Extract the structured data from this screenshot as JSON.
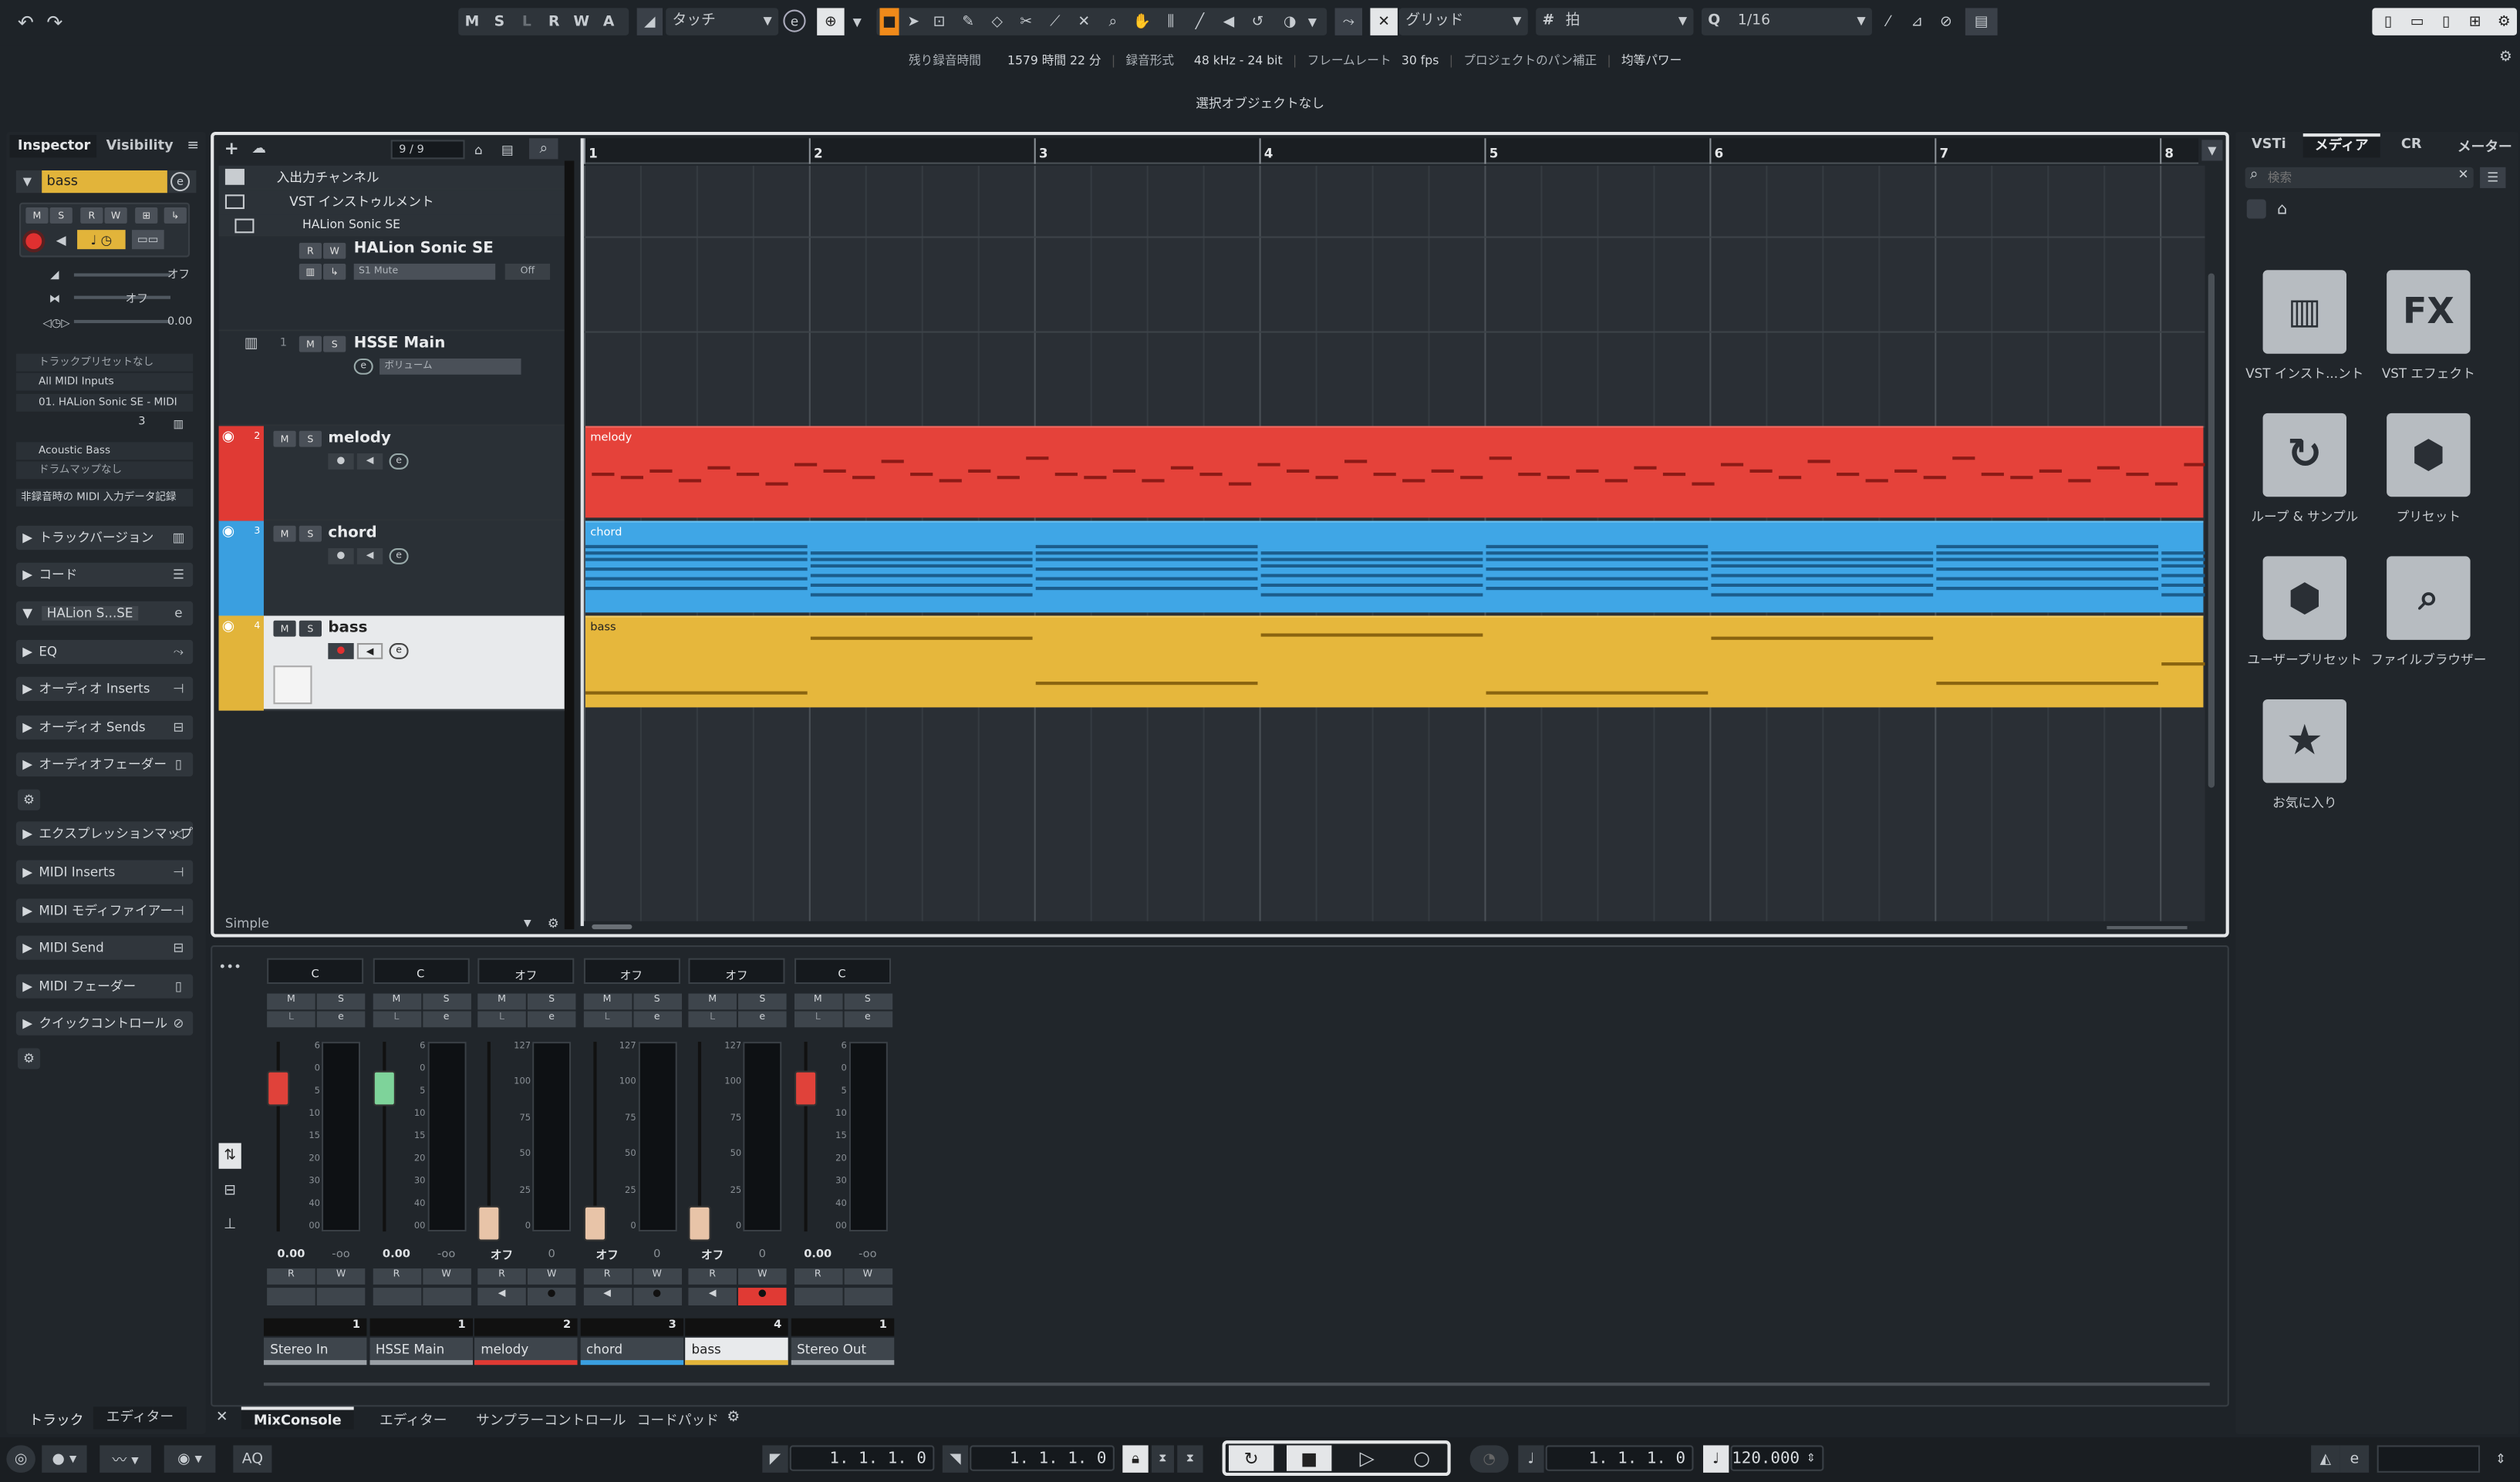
{
  "toolbar": {
    "mode_buttons": [
      "M",
      "S",
      "L",
      "R",
      "W",
      "A"
    ],
    "automation_mode": "タッチ",
    "snap_type": "グリッド",
    "grid_type": "拍",
    "quantize": "1/16"
  },
  "status_bar": {
    "rec_time_label": "残り録音時間",
    "rec_time_value": "1579 時間 22 分",
    "rec_format_label": "録音形式",
    "rec_format_value": "48 kHz - 24 bit",
    "frame_rate_label": "フレームレート",
    "frame_rate_value": "30 fps",
    "pan_label": "プロジェクトのパン補正",
    "pan_value": "均等パワー"
  },
  "info_line": "選択オブジェクトなし",
  "inspector": {
    "tabs": [
      "Inspector",
      "Visibility"
    ],
    "track_name": "bass",
    "volume_off": "オフ",
    "pan_off": "オフ",
    "delay": "0.00",
    "preset": "トラックプリセットなし",
    "input": "All MIDI Inputs",
    "output": "01. HALion Sonic SE - MIDI",
    "channel": "3",
    "program": "Acoustic Bass",
    "drum_map": "ドラムマップなし",
    "midi_input_rec": "非録音時の MIDI 入力データ記録",
    "sections": [
      "トラックバージョン",
      "コード",
      "HALion S...SE",
      "EQ",
      "オーディオ Inserts",
      "オーディオ Sends",
      "オーディオフェーダー",
      "エクスプレッションマップ",
      "MIDI Inserts",
      "MIDI モディファイアー",
      "MIDI Send",
      "MIDI フェーダー",
      "クイックコントロール"
    ]
  },
  "tracklist": {
    "counter": "9 / 9",
    "folder_io": "入出力チャンネル",
    "folder_vst": "VST インストゥルメント",
    "folder_halion": "HALion Sonic SE",
    "instrument": "HALion Sonic SE",
    "mute_label": "S1 Mute",
    "mute_value": "Off",
    "hsse_name": "HSSE Main",
    "hsse_num": "1",
    "hsse_vol": "ボリューム",
    "tracks": [
      {
        "num": "2",
        "name": "melody",
        "color": "#e03a34"
      },
      {
        "num": "3",
        "name": "chord",
        "color": "#3a9fe0"
      },
      {
        "num": "4",
        "name": "bass",
        "color": "#e2b43a"
      }
    ],
    "footer": "Simple"
  },
  "ruler": [
    "1",
    "2",
    "3",
    "4",
    "5",
    "6",
    "7",
    "8"
  ],
  "parts": {
    "melody": "melody",
    "chord": "chord",
    "bass": "bass"
  },
  "right_zone": {
    "tabs": [
      "VSTi",
      "メディア",
      "CR",
      "メーター"
    ],
    "search_placeholder": "検索",
    "tiles": [
      "VST インスト...ント",
      "VST エフェクト",
      "ループ & サンプル",
      "プリセット",
      "ユーザープリセット",
      "ファイルブラウザー",
      "お気に入り"
    ]
  },
  "mixer": {
    "channels": [
      {
        "name": "Stereo In",
        "num": "1",
        "top": "C",
        "val": "0.00",
        "peak": "-oo",
        "fader": "red"
      },
      {
        "name": "HSSE Main",
        "num": "1",
        "top": "C",
        "val": "0.00",
        "peak": "-oo",
        "fader": "green"
      },
      {
        "name": "melody",
        "num": "2",
        "top": "オフ",
        "val": "オフ",
        "peak": "0",
        "fader": "midi"
      },
      {
        "name": "chord",
        "num": "3",
        "top": "オフ",
        "val": "オフ",
        "peak": "0",
        "fader": "midi"
      },
      {
        "name": "bass",
        "num": "4",
        "top": "オフ",
        "val": "オフ",
        "peak": "0",
        "fader": "midi"
      },
      {
        "name": "Stereo Out",
        "num": "1",
        "top": "C",
        "val": "0.00",
        "peak": "-oo",
        "fader": "red"
      }
    ],
    "audio_scale": [
      "6",
      "0",
      "5",
      "10",
      "15",
      "20",
      "30",
      "40",
      "00"
    ],
    "midi_scale": [
      "127",
      "100",
      "75",
      "50",
      "25",
      "0"
    ]
  },
  "bottom_tabs": {
    "left": [
      "トラック",
      "エディター"
    ],
    "main": [
      "MixConsole",
      "エディター",
      "サンプラーコントロール",
      "コードパッド"
    ]
  },
  "transport": {
    "pos_left": "1. 1. 1.   0",
    "pos_right": "1. 1. 1.   0",
    "pos_main": "1. 1. 1.   0",
    "tempo": "120.000",
    "aq": "AQ"
  }
}
